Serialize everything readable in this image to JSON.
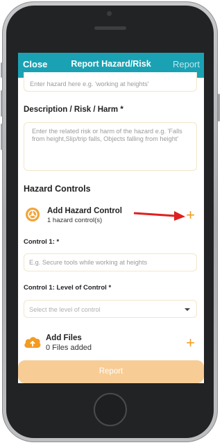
{
  "appbar": {
    "close_label": "Close",
    "title": "Report Hazard/Risk",
    "report_label": "Report"
  },
  "hazard_field": {
    "placeholder": "Enter hazard here e.g. 'working at heights'"
  },
  "description": {
    "label": "Description / Risk / Harm *",
    "placeholder": "Enter the related risk or harm of the hazard e.g. 'Falls from height,Slip/trip falls, Objects falling from height'"
  },
  "hazard_controls": {
    "heading": "Hazard Controls",
    "add_title": "Add Hazard Control",
    "count_text": "1 hazard control(s)",
    "control_label": "Control 1: *",
    "control_placeholder": "E.g. Secure tools while working at heights",
    "level_label": "Control 1: Level of Control *",
    "level_placeholder": "Select the level of control"
  },
  "files": {
    "title": "Add Files",
    "count_text": "0 Files added"
  },
  "footer": {
    "report_button": "Report"
  },
  "colors": {
    "appbar": "#1aa2b4",
    "accent": "#f39b22",
    "report_button": "#f7cc95",
    "annotation_arrow": "#e02020"
  }
}
